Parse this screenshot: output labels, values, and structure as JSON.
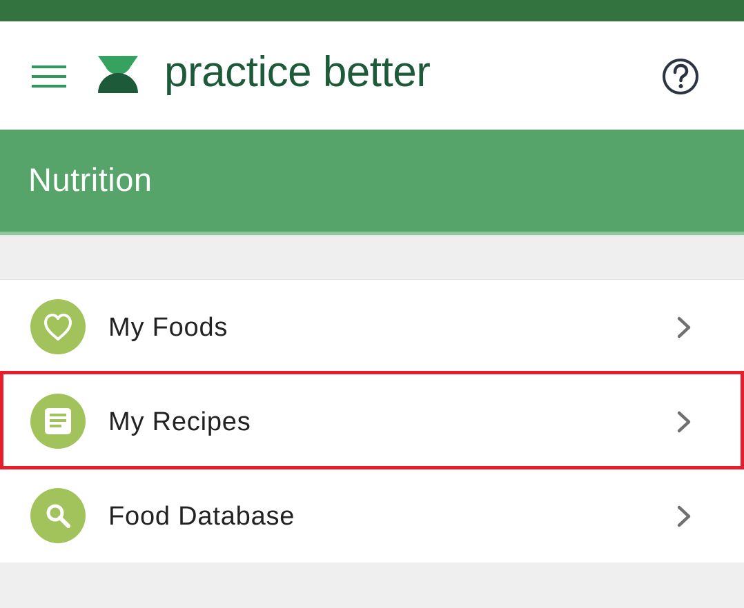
{
  "app": {
    "brand": "practice better"
  },
  "page": {
    "title": "Nutrition"
  },
  "menu_items": [
    {
      "label": "My Foods",
      "icon": "heart-icon"
    },
    {
      "label": "My Recipes",
      "icon": "recipe-icon"
    },
    {
      "label": "Food Database",
      "icon": "search-icon"
    }
  ],
  "colors": {
    "status_strip": "#327340",
    "brand_text": "#1c5a3a",
    "page_bar": "#57a46b",
    "icon_circle": "#a2c35b",
    "highlight": "#e61d2a"
  }
}
